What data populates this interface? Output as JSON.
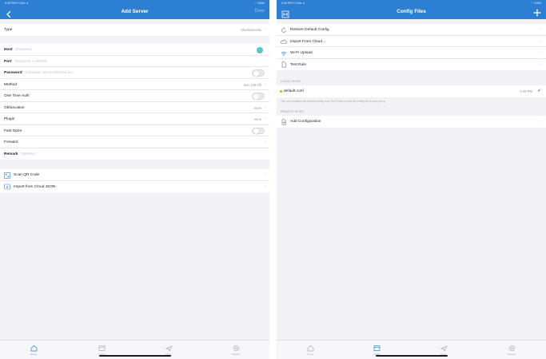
{
  "left": {
    "status_time": "9:49 PM  Fri Dec 4",
    "status_right": "⌔  100%",
    "title": "Add Server",
    "done_label": "Done",
    "type_row": {
      "label": "Type",
      "value": "Shadowsocks"
    },
    "fields": {
      "host": {
        "label": "Host",
        "placeholder": "Required"
      },
      "port": {
        "label": "Port",
        "placeholder": "Required 1~65535"
      },
      "password": {
        "label": "Password",
        "placeholder": "Optional, recommended 16+"
      },
      "method": {
        "label": "Method",
        "value": "aes-128-cfb"
      },
      "ota": {
        "label": "One Time Auth"
      },
      "obfuscation": {
        "label": "Obfuscation",
        "value": "none"
      },
      "plugin": {
        "label": "Plugin",
        "value": "none"
      },
      "fast_open": {
        "label": "Fast Open"
      },
      "forward": {
        "label": "Forward"
      },
      "remark": {
        "label": "Remark",
        "placeholder": "Optional"
      }
    },
    "actions": {
      "scan_qr": "Scan QR Code",
      "import_json": "Import from Cloud JSON"
    }
  },
  "right": {
    "status_time": "9:49 PM  Fri Dec 4",
    "status_right": "⌔  100%",
    "title": "Config Files",
    "menu": {
      "restore": "Restore Default Config",
      "import_cloud": "Import From Cloud...",
      "wifi_upload": "Wi-Fi Upload",
      "test_rule": "Test Rule"
    },
    "local_head": "LOCAL FILES",
    "local_file": {
      "name": "default.conf",
      "time": "9:45 PM"
    },
    "local_note": "The conf contains the default config, use Conf Editor to edit the config file to your proxy.",
    "remote_head": "REMOTE FILES",
    "add_config": "Add Configuration"
  },
  "tabs": [
    "Home",
    "Config",
    "Proxy",
    "Settings"
  ],
  "colors": {
    "accent": "#2d7fd3",
    "toggle_teal": "#58c7c4",
    "local_dot": "#f0a020"
  }
}
